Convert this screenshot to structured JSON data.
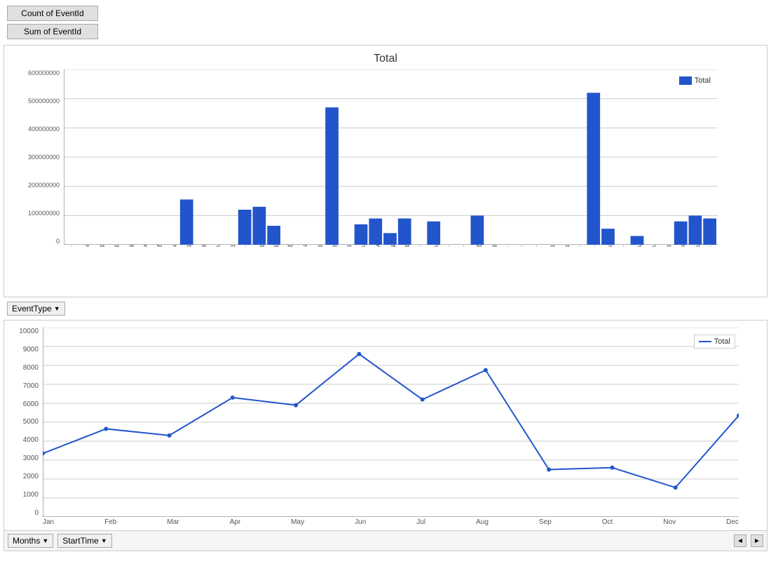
{
  "buttons": {
    "count_label": "Count of EventId",
    "sum_label": "Sum of EventId"
  },
  "bar_chart": {
    "title": "Total",
    "legend": "Total",
    "y_axis": [
      "0",
      "100000000",
      "200000000",
      "300000000",
      "400000000",
      "500000000",
      "600000000"
    ],
    "categories": [
      "Astronomical...",
      "Avalanche",
      "Blizzard",
      "Coastal Flood",
      "Cold/Wind Chill",
      "Debris Flow",
      "Dense Fog",
      "Dense Smoke",
      "Drought",
      "Dust Devil",
      "Dust Storm",
      "Excessive Heat",
      "Extreme...",
      "Flash Flood",
      "Flood",
      "Freezing Fog",
      "Frost/Freeze",
      "Funnel Cloud",
      "Hail",
      "Heat",
      "Heavy Rain",
      "Heavy Snow",
      "High Surf",
      "High Wind",
      "Hurricane...",
      "Ice Storm",
      "Lake-Effect...",
      "Lakeshore...",
      "Lightning",
      "Marine Hail",
      "Marine High...",
      "Marine Strong...",
      "Marine...",
      "Rip Current",
      "Sleet",
      "Storm...",
      "Thunderstorm...",
      "Tornado",
      "Tropical...",
      "Tropical Storm",
      "Volcanic Ash",
      "Waterspout",
      "Wildfire",
      "Winter Storm",
      "Winter..."
    ],
    "values": [
      5,
      3,
      5,
      5,
      60,
      5,
      30,
      5,
      155000000,
      5,
      15,
      5,
      120000000,
      130000000,
      65000000,
      5,
      50,
      5,
      470000000,
      50,
      70000000,
      90000000,
      40000000,
      90000000,
      5,
      80000000,
      5,
      5,
      100000000,
      5,
      5,
      5,
      5,
      5,
      5,
      5,
      520000000,
      55000000,
      5,
      30000000,
      5,
      5,
      80000000,
      100000000,
      90000000
    ]
  },
  "line_chart": {
    "legend": "Total",
    "y_axis": [
      "0",
      "1000",
      "2000",
      "3000",
      "4000",
      "5000",
      "6000",
      "7000",
      "8000",
      "9000",
      "10000"
    ],
    "x_axis": [
      "Jan",
      "Feb",
      "Mar",
      "Apr",
      "May",
      "Jun",
      "Jul",
      "Aug",
      "Sep",
      "Oct",
      "Nov",
      "Dec"
    ],
    "values": [
      3350,
      4650,
      4300,
      6300,
      5900,
      8600,
      6200,
      7750,
      2500,
      2600,
      1550,
      5350
    ]
  },
  "bottom_controls": {
    "months_label": "Months",
    "start_time_label": "StartTime",
    "dropdown_arrow": "▼",
    "scroll_left": "◄",
    "scroll_right": "►"
  }
}
